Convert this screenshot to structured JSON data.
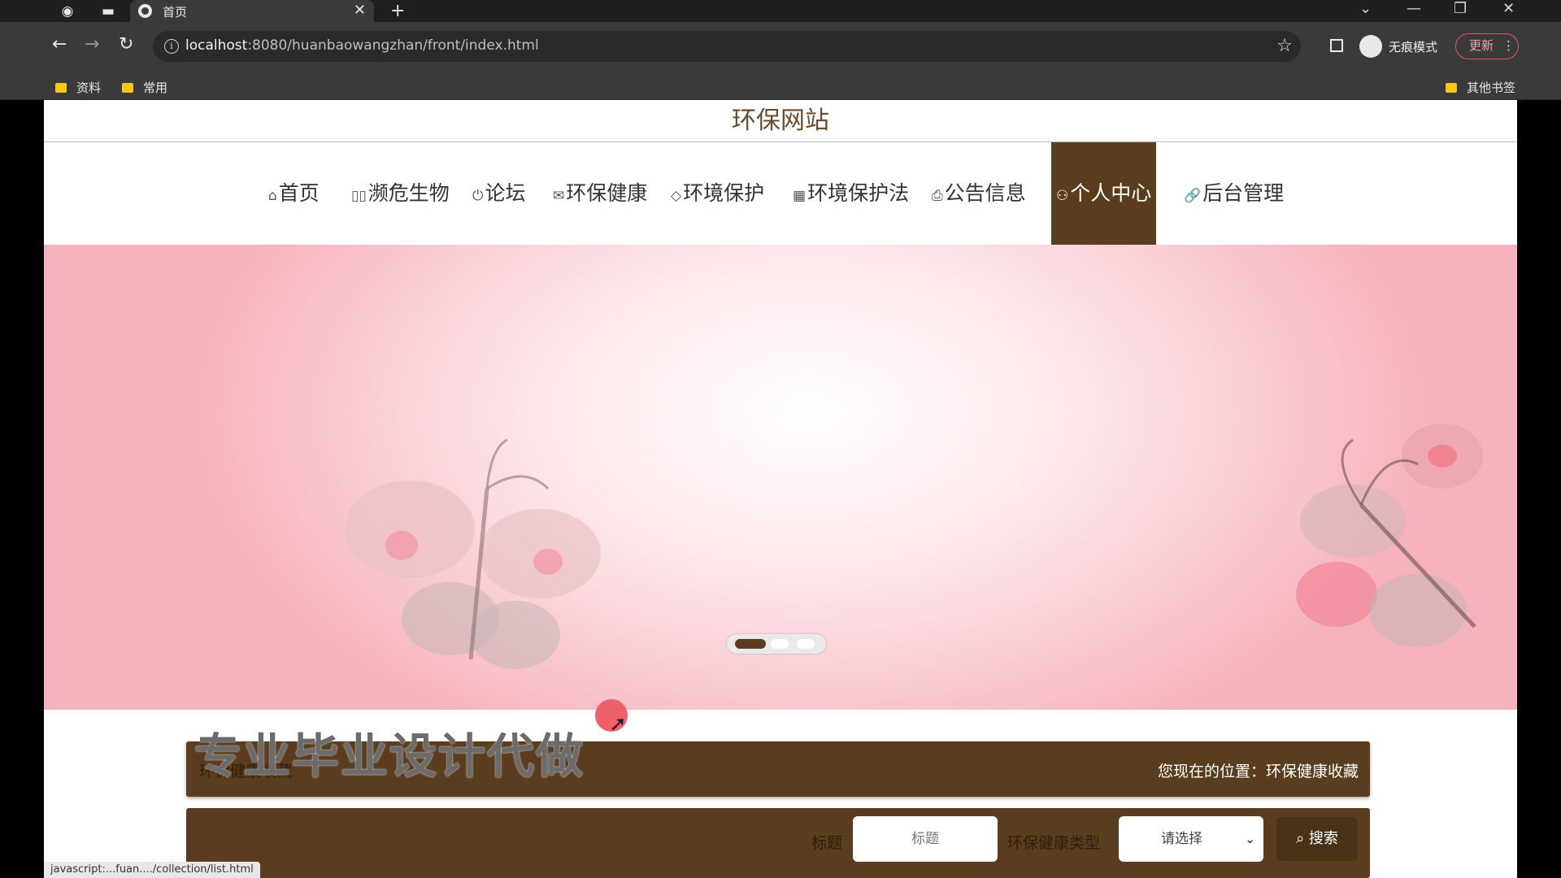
{
  "browser": {
    "tab_title": "首页",
    "new_tab_symbol": "+",
    "url_host": "localhost",
    "url_path": ":8080/huanbaowangzhan/front/index.html",
    "incognito_label": "无痕模式",
    "update_label": "更新",
    "bookmarks": [
      {
        "label": "资料"
      },
      {
        "label": "常用"
      }
    ],
    "other_bookmarks": "其他书签"
  },
  "site": {
    "title": "环保网站",
    "nav": [
      {
        "icon": "home-icon",
        "glyph": "⌂",
        "label": "首页"
      },
      {
        "icon": "grid-icon",
        "glyph": "▯▯",
        "label": "濒危生物"
      },
      {
        "icon": "power-icon",
        "glyph": "⏻",
        "label": "论坛"
      },
      {
        "icon": "mail-icon",
        "glyph": "✉",
        "label": "环保健康"
      },
      {
        "icon": "tag-icon",
        "glyph": "◇",
        "label": "环境保护"
      },
      {
        "icon": "grid-icon",
        "glyph": "▦",
        "label": "环境保护法"
      },
      {
        "icon": "print-icon",
        "glyph": "⎙",
        "label": "公告信息"
      },
      {
        "icon": "user-icon",
        "glyph": "⚇",
        "label": "个人中心",
        "active": true
      },
      {
        "icon": "link-icon",
        "glyph": "🔗",
        "label": "后台管理"
      }
    ],
    "carousel": {
      "slides": 3,
      "active_index": 0
    },
    "watermark": "专业毕业设计代做",
    "breadcrumb": {
      "left": "环保健康收藏",
      "right": "您现在的位置：环保健康收藏"
    },
    "search": {
      "title_label": "标题",
      "title_placeholder": "标题",
      "type_label": "环保健康类型",
      "type_selected": "请选择",
      "button_label": "搜索"
    },
    "status_link": "javascript:...fuan..../collection/list.html"
  },
  "colors": {
    "brand_brown": "#5a3d1f",
    "banner_pink": "#f6b3bd"
  }
}
